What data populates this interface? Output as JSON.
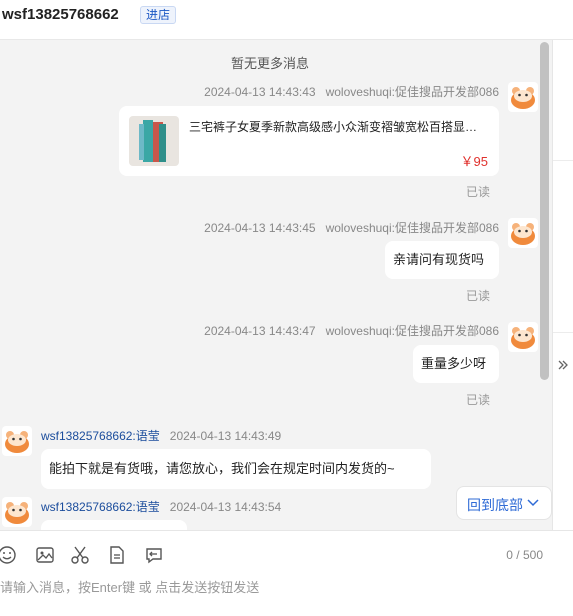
{
  "header": {
    "title": "wsf13825768662",
    "badge": "进店"
  },
  "chat": {
    "no_more": "暂无更多消息",
    "messages": [
      {
        "time": "2024-04-13 14:43:43",
        "sender": "woloveshuqi:促佳搜品开发部086",
        "type": "product",
        "product_title": "三宅裤子女夏季新款高级感小众渐变褶皱宽松百搭显瘦直筒阔腿裤",
        "price": "￥95",
        "status": "已读"
      },
      {
        "time": "2024-04-13 14:43:45",
        "sender": "woloveshuqi:促佳搜品开发部086",
        "text": "亲请问有现货吗",
        "status": "已读"
      },
      {
        "time": "2024-04-13 14:43:47",
        "sender": "woloveshuqi:促佳搜品开发部086",
        "text": "重量多少呀",
        "status": "已读"
      },
      {
        "time": "2024-04-13 14:43:49",
        "sender": "wsf13825768662:语莹",
        "text": "能拍下就是有货哦，请您放心，我们会在规定时间内发货的~"
      },
      {
        "time": "2024-04-13 14:43:54",
        "sender": "wsf13825768662:语莹",
        "text": ""
      }
    ],
    "back_to_bottom": "回到底部"
  },
  "input": {
    "counter": "0 / 500",
    "placeholder": "请输入消息，按Enter键 或 点击发送按钮发送",
    "value": ""
  },
  "icons": {
    "toolbar": [
      "emoji-icon",
      "image-icon",
      "scissors-icon",
      "file-icon",
      "quick-reply-icon"
    ],
    "side": "double-chevron-right-icon"
  },
  "colors": {
    "link_blue": "#2f6bd6",
    "sender_blue": "#1a4c9c",
    "price_red": "#e0312d",
    "chat_bg": "#f3f3f3"
  }
}
